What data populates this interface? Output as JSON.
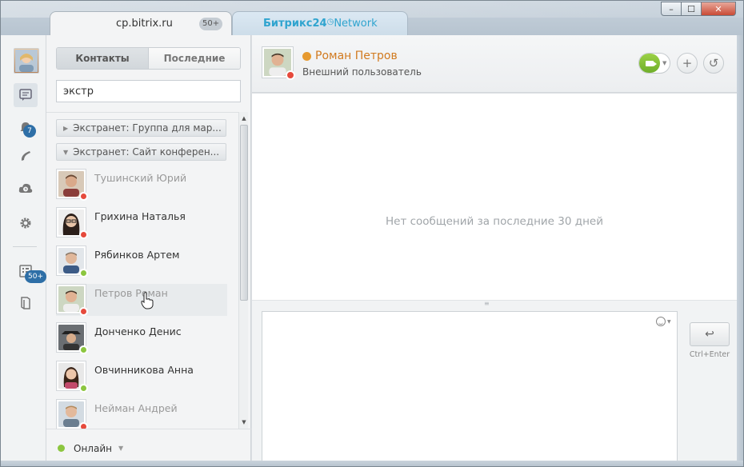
{
  "window": {
    "tabs": [
      {
        "title": "cp.bitrix.ru",
        "badge": "50+"
      },
      {
        "title_bold": "Битрикс24",
        "title_light": "Network"
      }
    ],
    "controls": {
      "minimize": "–",
      "maximize": "☐",
      "close": "✕"
    }
  },
  "rail": {
    "notifications_badge": "7",
    "apps_badge": "50+"
  },
  "contacts_panel": {
    "segments": [
      "Контакты",
      "Последние"
    ],
    "active_segment": "Контакты",
    "search_value": "экстр",
    "groups": [
      {
        "label": "Экстранет: Группа для мар..."
      },
      {
        "label": "Экстранет: Сайт конферен..."
      }
    ],
    "contacts": [
      {
        "name": "Тушинский Юрий",
        "status": "offline",
        "status_color": "#e64a3c"
      },
      {
        "name": "Грихина Наталья",
        "status": "dnd",
        "status_color": "#e64a3c"
      },
      {
        "name": "Рябинков Артем",
        "status": "online",
        "status_color": "#8cc63f"
      },
      {
        "name": "Петров Роман",
        "status": "offline",
        "status_color": "#e64a3c"
      },
      {
        "name": "Донченко Денис",
        "status": "online",
        "status_color": "#8cc63f"
      },
      {
        "name": "Овчинникова Анна",
        "status": "online",
        "status_color": "#8cc63f"
      },
      {
        "name": "Нейман Андрей",
        "status": "offline",
        "status_color": "#e64a3c"
      }
    ],
    "status": "Онлайн"
  },
  "chat": {
    "contact_name": "Роман Петров",
    "contact_subtitle": "Внешний пользователь",
    "empty_message": "Нет сообщений за последние 30 дней",
    "send_hint": "Ctrl+Enter",
    "add_icon": "+",
    "history_icon": "↺",
    "send_icon": "↩"
  },
  "colors": {
    "online": "#8cc63f",
    "offline": "#e64a3c",
    "accent_name": "#d17a1f",
    "network_blue": "#2fa4cf"
  }
}
